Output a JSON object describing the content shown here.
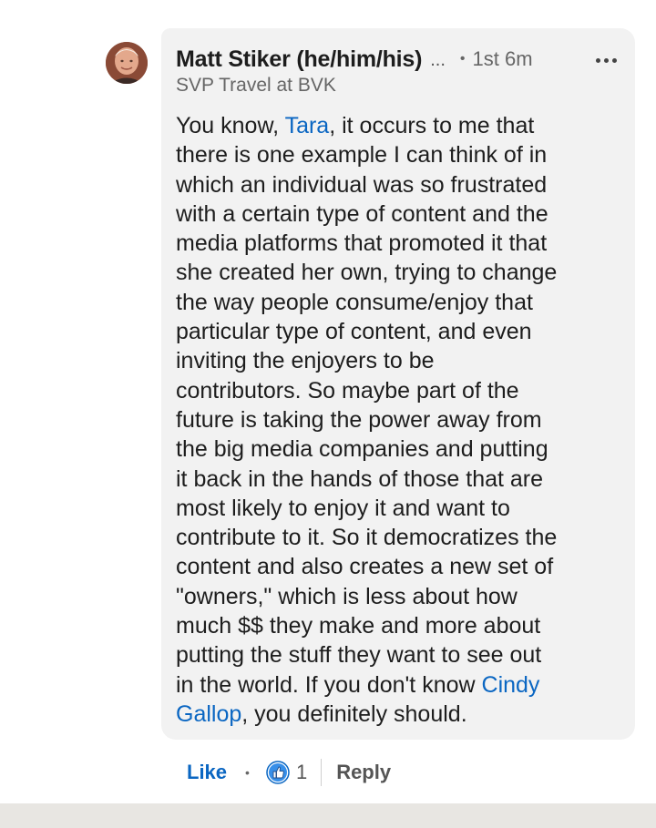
{
  "comment": {
    "author": {
      "name": "Matt Stiker (he/him/his)",
      "truncation": "...",
      "separator": "•",
      "degree_time": "1st 6m",
      "headline": "SVP Travel at BVK"
    },
    "body_lines": [
      [
        {
          "t": "You know, "
        },
        {
          "t": "Tara",
          "mention": true
        },
        {
          "t": ", it occurs to me that"
        }
      ],
      [
        {
          "t": "there is one example I can think of in"
        }
      ],
      [
        {
          "t": "which an individual was so frustrated"
        }
      ],
      [
        {
          "t": "with a certain type of content and the"
        }
      ],
      [
        {
          "t": "media platforms that promoted it that"
        }
      ],
      [
        {
          "t": "she created her own, trying to change"
        }
      ],
      [
        {
          "t": "the way people consume/enjoy that"
        }
      ],
      [
        {
          "t": "particular type of content, and even"
        }
      ],
      [
        {
          "t": "inviting the enjoyers to be"
        }
      ],
      [
        {
          "t": "contributors. So maybe part of the"
        }
      ],
      [
        {
          "t": "future is taking the power away from"
        }
      ],
      [
        {
          "t": "the big media companies and putting"
        }
      ],
      [
        {
          "t": "it back in the hands of those that are"
        }
      ],
      [
        {
          "t": "most likely to enjoy it and want to"
        }
      ],
      [
        {
          "t": "contribute to it. So it democratizes the"
        }
      ],
      [
        {
          "t": "content and also creates a new set of"
        }
      ],
      [
        {
          "t": "\"owners,\" which is less about how"
        }
      ],
      [
        {
          "t": "much $$ they make and more about"
        }
      ],
      [
        {
          "t": "putting the stuff they want to see out"
        }
      ],
      [
        {
          "t": "in the world. If you don't know "
        },
        {
          "t": "Cindy",
          "mention": true
        }
      ],
      [
        {
          "t": "Gallop",
          "mention": true
        },
        {
          "t": ", you definitely should."
        }
      ]
    ],
    "actions": {
      "like_label": "Like",
      "separator": "•",
      "reaction_count": "1",
      "reply_label": "Reply"
    }
  },
  "colors": {
    "link": "#0a66c2",
    "bubble_bg": "#f2f2f2",
    "text": "#1d1d1d",
    "secondary": "#666666"
  },
  "icons": {
    "avatar": "profile-photo",
    "more": "more-options-icon",
    "reaction": "like-reaction-icon"
  }
}
